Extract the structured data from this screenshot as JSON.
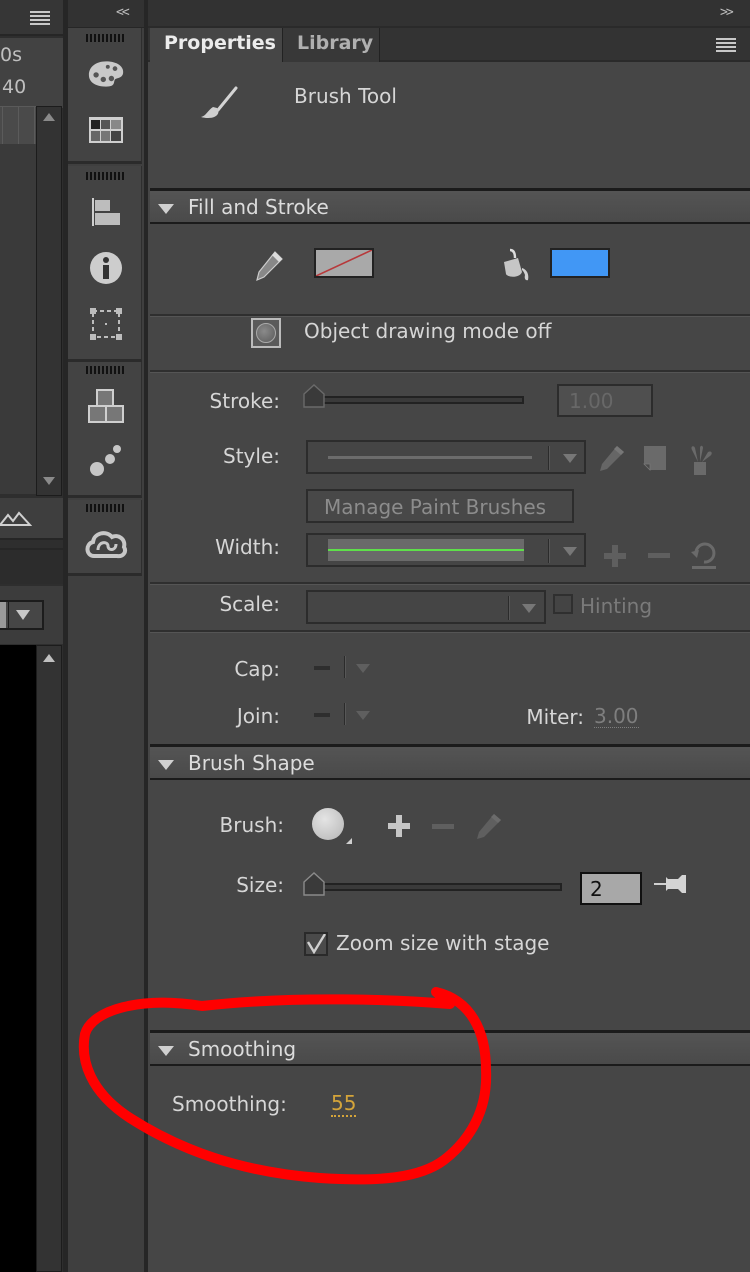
{
  "left_panel": {
    "time_label": "0s",
    "frame_label": "40"
  },
  "dock": {
    "collapse_label": "<<",
    "icons": [
      "color-palette",
      "swatches-grid",
      "align",
      "info",
      "transform",
      "components",
      "motion-presets",
      "creative-cloud-libraries"
    ]
  },
  "panel": {
    "expand_label": ">>",
    "tabs": [
      {
        "label": "Properties",
        "active": true
      },
      {
        "label": "Library",
        "active": false
      }
    ],
    "tool_name": "Brush Tool"
  },
  "fill_stroke": {
    "title": "Fill and Stroke",
    "stroke_color": "none",
    "fill_color": "#4197f5",
    "object_drawing_label": "Object drawing mode off",
    "stroke_label": "Stroke:",
    "stroke_value": "1.00",
    "style_label": "Style:",
    "manage_brushes_label": "Manage Paint Brushes",
    "width_label": "Width:",
    "scale_label": "Scale:",
    "hinting_label": "Hinting",
    "hinting_checked": false,
    "cap_label": "Cap:",
    "join_label": "Join:",
    "miter_label": "Miter:",
    "miter_value": "3.00"
  },
  "brush_shape": {
    "title": "Brush Shape",
    "brush_label": "Brush:",
    "size_label": "Size:",
    "size_value": "2",
    "zoom_label": "Zoom size with stage",
    "zoom_checked": true
  },
  "smoothing": {
    "title": "Smoothing",
    "label": "Smoothing:",
    "value": "55"
  },
  "colors": {
    "accent_value": "#d4a43a",
    "annotation": "#ff0000",
    "width_line": "#5ee04a"
  }
}
